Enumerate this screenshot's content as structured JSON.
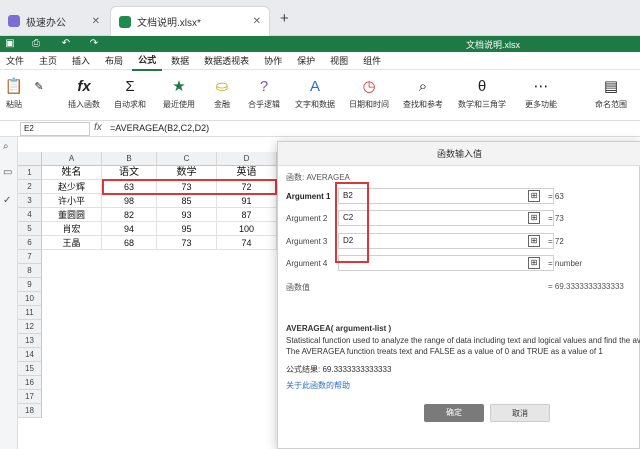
{
  "tabs": [
    {
      "label": "极速办公",
      "close": "✕"
    },
    {
      "label": "文档说明.xlsx*",
      "close": "✕"
    }
  ],
  "new_tab": "+",
  "window_title": "文档说明.xlsx",
  "menu": [
    "文件",
    "主页",
    "插入",
    "布局",
    "公式",
    "数据",
    "数据透视表",
    "协作",
    "保护",
    "视图",
    "组件"
  ],
  "ribbon": {
    "paste": "粘贴",
    "insert_function": "插入函数",
    "autosum": "自动求和",
    "recent": "最近使用",
    "finance": "金融",
    "logic": "合乎逻辑",
    "text_data": "文字和数据",
    "datetime": "日期和时间",
    "lookup": "查找和参考",
    "math": "数学和三角学",
    "more": "更多功能",
    "named_range": "命名范围"
  },
  "formula_bar": {
    "cell": "E2",
    "fx": "fx",
    "formula": "=AVERAGEA(B2,C2,D2)"
  },
  "grid": {
    "columns": [
      "A",
      "B",
      "C",
      "D"
    ],
    "rows": [
      "1",
      "2",
      "3",
      "4",
      "5",
      "6",
      "7",
      "8",
      "9",
      "10",
      "11",
      "12",
      "13",
      "14",
      "15",
      "16",
      "17",
      "18"
    ],
    "data": [
      [
        "姓名",
        "语文",
        "数学",
        "英语"
      ],
      [
        "赵少辉",
        "63",
        "73",
        "72"
      ],
      [
        "许小平",
        "98",
        "85",
        "91"
      ],
      [
        "董圆圆",
        "82",
        "93",
        "87"
      ],
      [
        "肖宏",
        "94",
        "95",
        "100"
      ],
      [
        "王晶",
        "68",
        "73",
        "74"
      ]
    ]
  },
  "dialog": {
    "title": "函数输入值",
    "func_label": "函数: AVERAGEA",
    "args": [
      {
        "label": "Argument 1",
        "value": "B2",
        "result": "= 63"
      },
      {
        "label": "Argument 2",
        "value": "C2",
        "result": "= 73"
      },
      {
        "label": "Argument 3",
        "value": "D2",
        "result": "= 72"
      },
      {
        "label": "Argument 4",
        "value": "",
        "result": "= number"
      }
    ],
    "func_value_label": "函数值",
    "func_value": "= 69.3333333333333",
    "syntax": "AVERAGEA( argument-list )",
    "desc1": "Statistical function used to analyze the range of data including text and logical values and find the av",
    "desc2": "The AVERAGEA function treats text and FALSE as a value of 0 and TRUE as a value of 1",
    "formula_result": "公式结果: 69.3333333333333",
    "help_link": "关于此函数的帮助",
    "ok": "确定",
    "cancel": "取消"
  },
  "colors": {
    "accent": "#1e7a45",
    "highlight": "#d9363e"
  }
}
